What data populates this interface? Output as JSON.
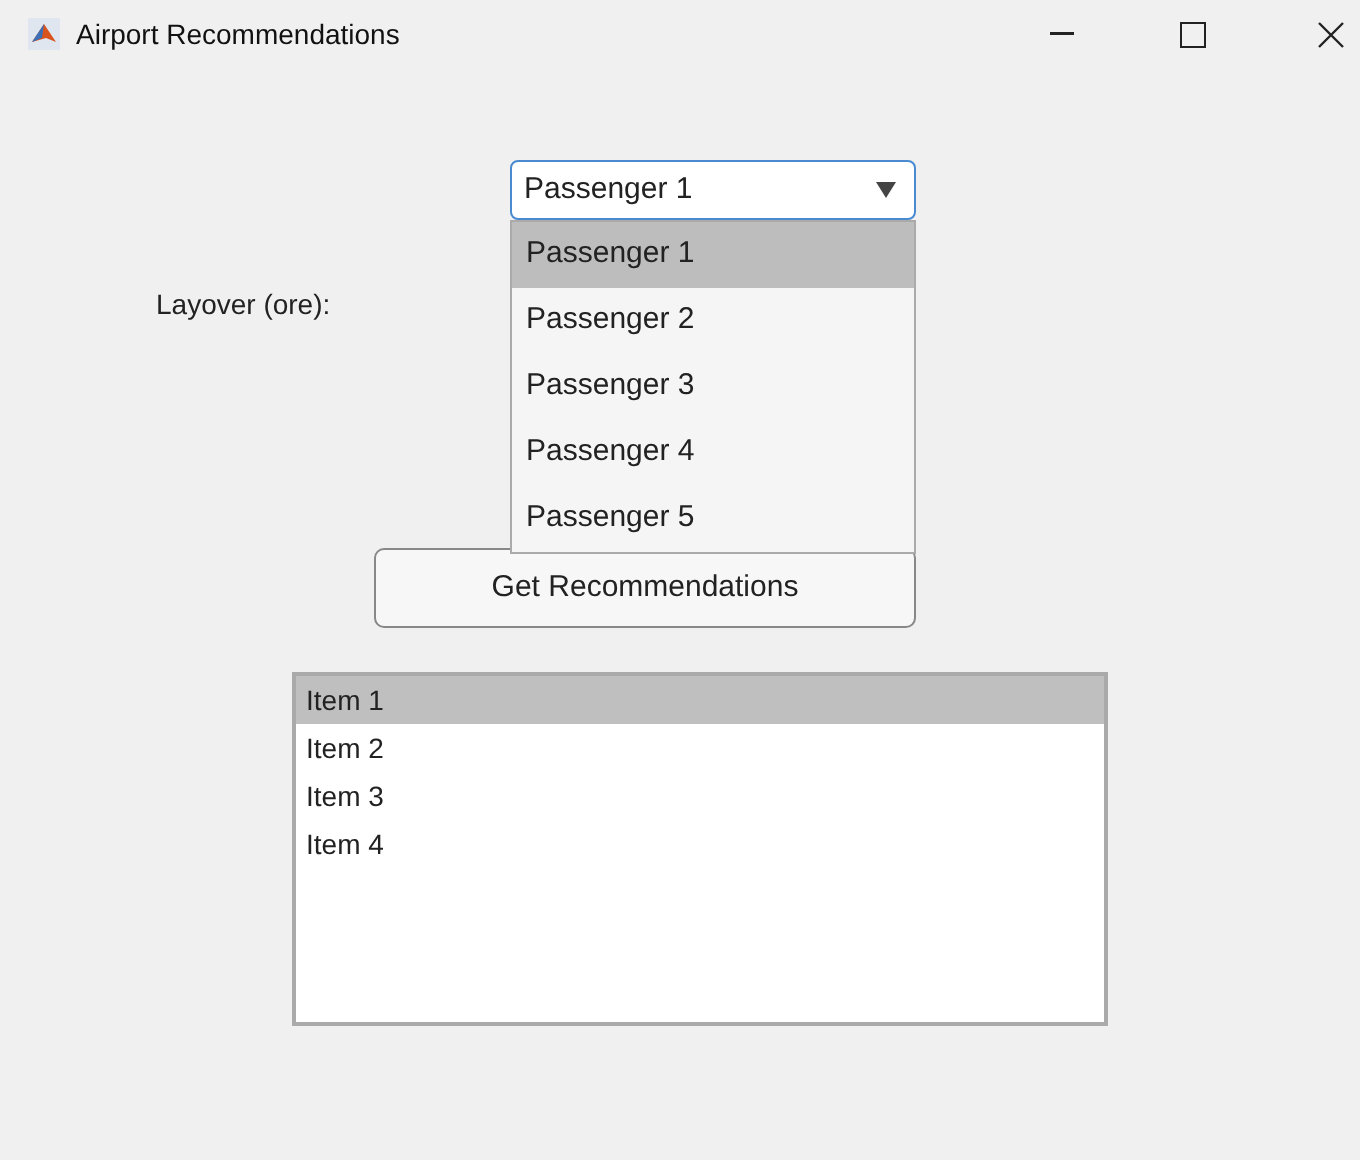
{
  "window": {
    "title": "Airport Recommendations"
  },
  "layover_label": "Layover (ore):",
  "dropdown": {
    "value": "Passenger 1",
    "expanded": true,
    "options": [
      {
        "label": "Passenger 1",
        "selected": true
      },
      {
        "label": "Passenger 2",
        "selected": false
      },
      {
        "label": "Passenger 3",
        "selected": false
      },
      {
        "label": "Passenger 4",
        "selected": false
      },
      {
        "label": "Passenger 5",
        "selected": false
      }
    ]
  },
  "button": "Get Recommendations",
  "listbox": {
    "items": [
      {
        "label": "Item 1",
        "selected": true
      },
      {
        "label": "Item 2",
        "selected": false
      },
      {
        "label": "Item 3",
        "selected": false
      },
      {
        "label": "Item 4",
        "selected": false
      }
    ]
  }
}
